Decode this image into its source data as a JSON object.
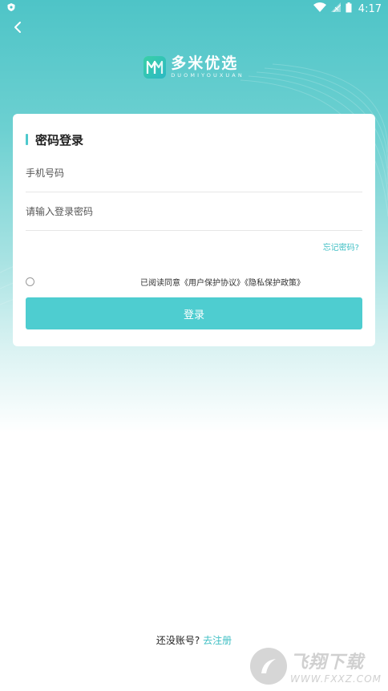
{
  "status_bar": {
    "time": "4:17",
    "icons": [
      "shield-icon",
      "wifi-icon",
      "signal-icon",
      "battery-icon"
    ]
  },
  "header": {
    "back_icon": "chevron-left-icon"
  },
  "logo": {
    "name_cn": "多米优选",
    "name_en": "DUOMIYOUXUAN"
  },
  "login_card": {
    "title": "密码登录",
    "phone_placeholder": "手机号码",
    "password_placeholder": "请输入登录密码",
    "forgot_password": "忘记密码?",
    "agreement_prefix": "已阅读同意",
    "user_agreement": "《用户保护协议》",
    "privacy_policy": "《隐私保护政策》",
    "login_button": "登录"
  },
  "footer": {
    "no_account": "还没账号?",
    "register_link": "去注册"
  },
  "watermark": {
    "site_cn": "飞翔下载",
    "site_en": "WWW.FXXZ.COM"
  },
  "colors": {
    "accent": "#4ecdd0",
    "link": "#3fbfc4",
    "header_gradient_top": "#4ec4c7"
  }
}
